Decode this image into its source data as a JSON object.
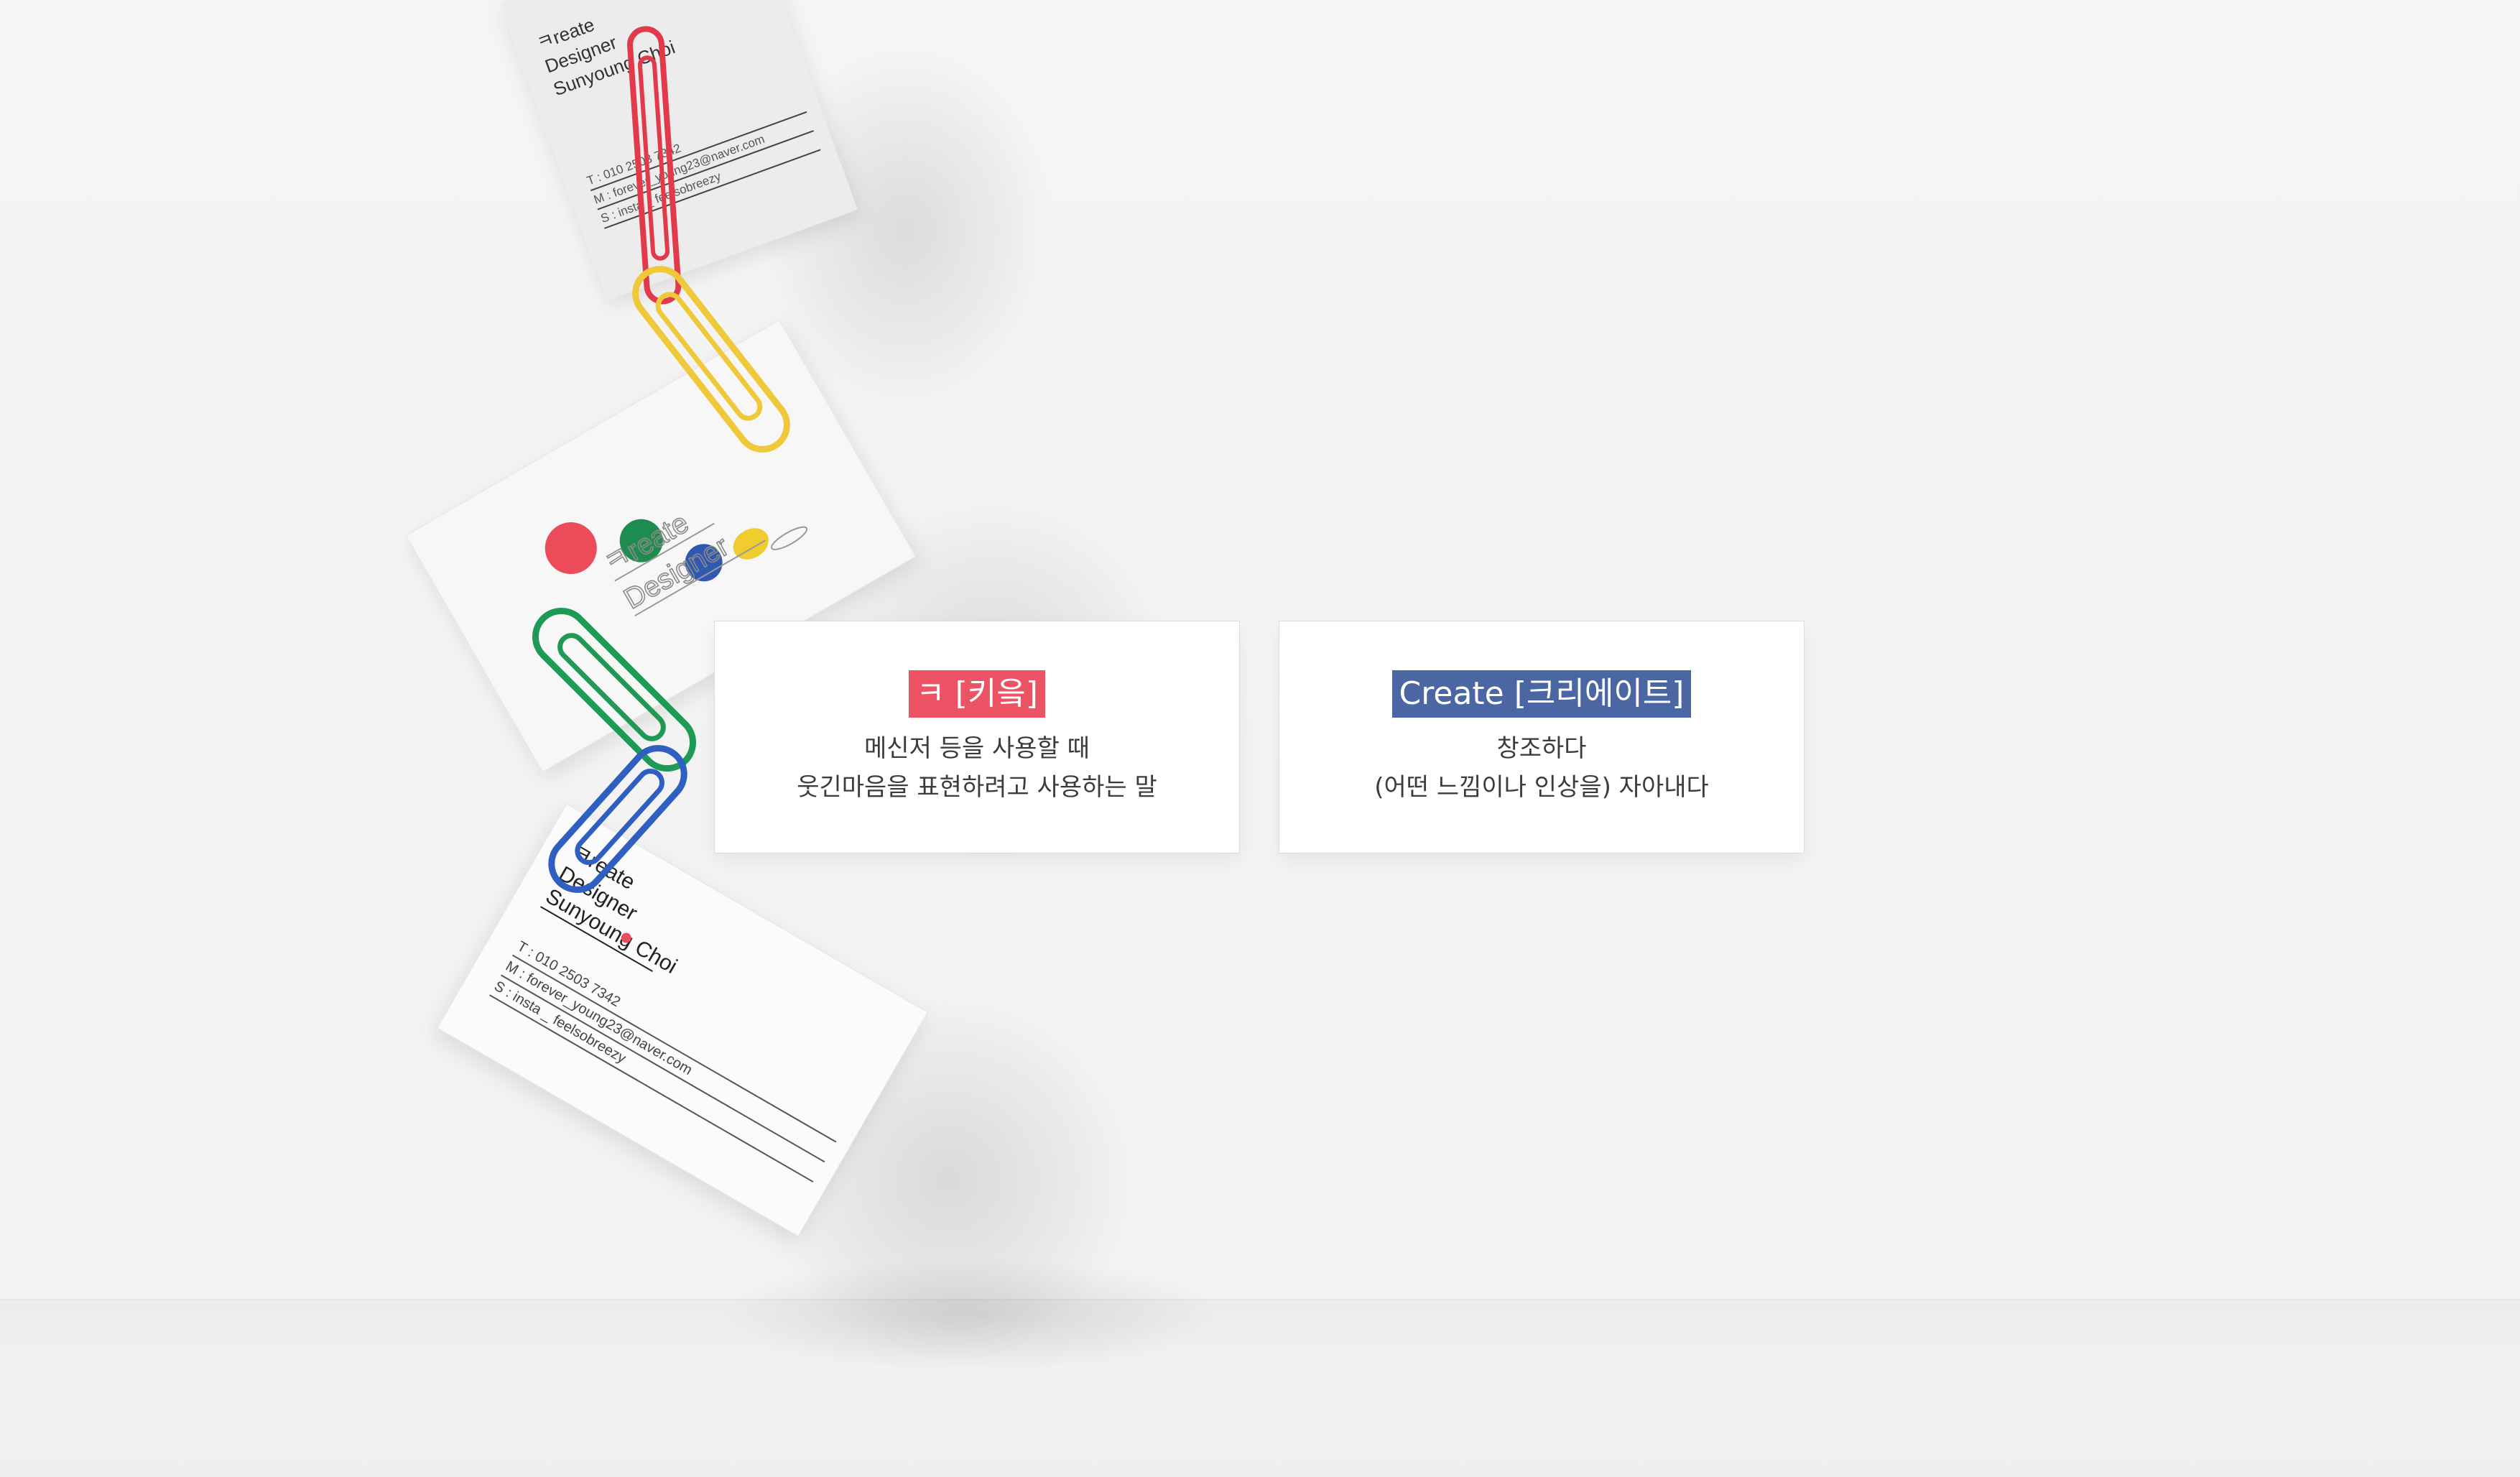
{
  "top_card": {
    "name_lines": [
      "ㅋreate",
      "Designer",
      "Sunyoung Choi"
    ],
    "contact": [
      "T : 010 2503 7342",
      "M : forever_young23@naver.com",
      "S : insta _ feelsobreezy"
    ]
  },
  "middle_card": {
    "logo_lines": [
      "ㅋreate",
      "Designer"
    ]
  },
  "bottom_card": {
    "name_lines": [
      "ㅋreate",
      "Designer",
      "Sunyoung Choi"
    ],
    "contact": [
      "T : 010 2503 7342",
      "M : forever_young23@naver.com",
      "S : insta _ feelsobreezy"
    ]
  },
  "definitions": [
    {
      "term": "ㅋ [키읔]",
      "color": "#ec5364",
      "lines": [
        "메신저 등을 사용할 때",
        "웃긴마음을 표현하려고 사용하는 말"
      ]
    },
    {
      "term": "Create [크리에이트]",
      "color": "#4a66a3",
      "lines": [
        "창조하다",
        "(어떤 느낌이나 인상을) 자아내다"
      ]
    }
  ],
  "colors": {
    "red": "#ec4b5a",
    "green": "#1e8c4e",
    "blue": "#2f58b0",
    "yellow": "#f0cc2e"
  }
}
